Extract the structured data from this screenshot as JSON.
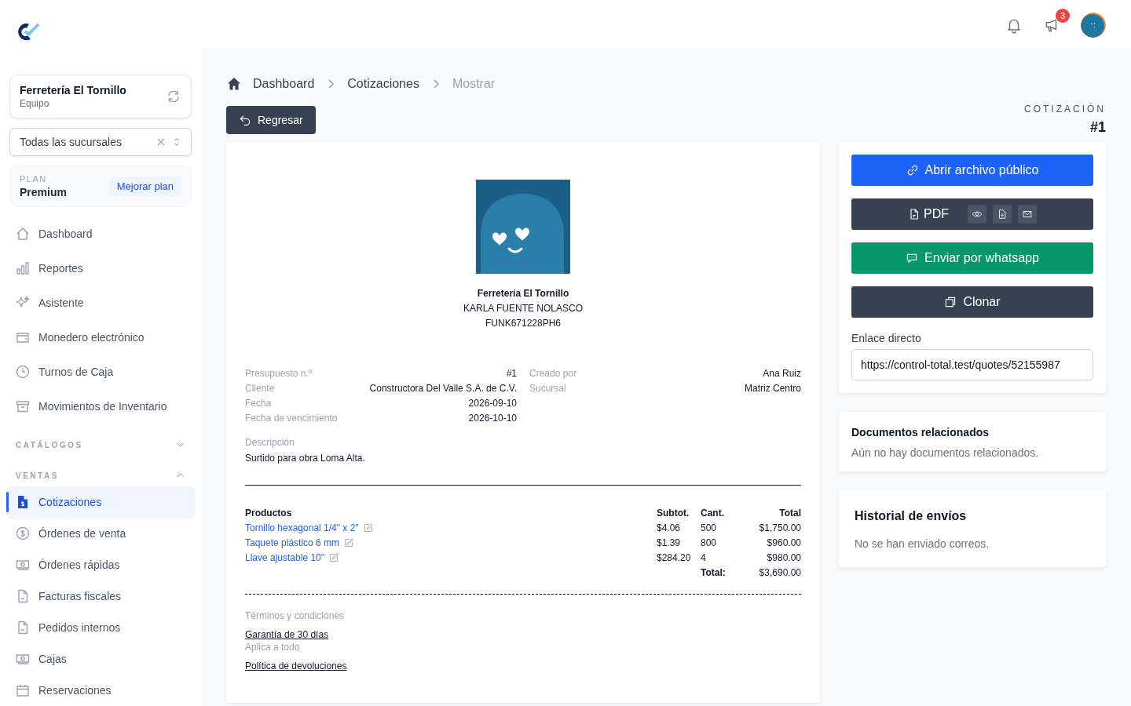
{
  "topbar": {
    "notification_count": "3"
  },
  "team": {
    "name": "Ferretería El Tornillo",
    "role": "Equipo"
  },
  "branch_select": {
    "value": "Todas las sucursales"
  },
  "plan": {
    "label": "PLAN",
    "name": "Premium",
    "upgrade": "Mejorar plan"
  },
  "sidebar": {
    "items": [
      {
        "label": "Dashboard",
        "selected": false
      },
      {
        "label": "Reportes",
        "selected": false
      },
      {
        "label": "Asistente",
        "selected": false
      },
      {
        "label": "Monedero electrónico",
        "selected": false
      },
      {
        "label": "Turnos de Caja",
        "selected": false
      },
      {
        "label": "Movimientos de Inventario",
        "selected": false
      }
    ],
    "sections": [
      {
        "title": "CATÁLOGOS",
        "expanded": false
      },
      {
        "title": "VENTAS",
        "expanded": true,
        "children": [
          {
            "label": "Cotizaciones",
            "selected": true
          },
          {
            "label": "Órdenes de venta",
            "selected": false
          },
          {
            "label": "Órdenes rápidas",
            "selected": false
          },
          {
            "label": "Facturas fiscales",
            "selected": false
          },
          {
            "label": "Pedidos internos",
            "selected": false
          },
          {
            "label": "Cajas",
            "selected": false
          },
          {
            "label": "Reservaciones",
            "selected": false
          }
        ]
      }
    ]
  },
  "breadcrumb": [
    {
      "label": "Dashboard",
      "current": false
    },
    {
      "label": "Cotizaciones",
      "current": false
    },
    {
      "label": "Mostrar",
      "current": true
    }
  ],
  "back_button": "Regresar",
  "doc_header": {
    "kind_label": "COTIZACIÓN",
    "number": "#1"
  },
  "quote": {
    "company": "Ferretería El Tornillo",
    "contact": "KARLA FUENTE NOLASCO",
    "tax_id": "FUNK671228PH6",
    "details_left": [
      {
        "label": "Presupuesto n.º",
        "value": "#1"
      },
      {
        "label": "Cliente",
        "value": "Constructora Del Valle S.A. de C.V."
      },
      {
        "label": "Fecha",
        "value": "2026-09-10"
      },
      {
        "label": "Fecha de vencimiento",
        "value": "2026-10-10"
      }
    ],
    "details_right": [
      {
        "label": "Creado por",
        "value": "Ana Ruiz"
      },
      {
        "label": "Sucursal",
        "value": "Matriz Centro"
      }
    ],
    "description_label": "Descripción",
    "description": "Surtido para obra Loma Alta.",
    "table": {
      "columns": [
        "Productos",
        "Subtot.",
        "Cant.",
        "Total"
      ],
      "rows": [
        {
          "product": "Tornillo hexagonal 1/4\" x 2\"",
          "subtotal": "$4.06",
          "qty": "500",
          "total": "$1,750.00"
        },
        {
          "product": "Taquete plástico 6 mm",
          "subtotal": "$1.39",
          "qty": "800",
          "total": "$960.00"
        },
        {
          "product": "Llave ajustable 10\"",
          "subtotal": "$284.20",
          "qty": "4",
          "total": "$980.00"
        }
      ],
      "total_label": "Total:",
      "total": "$3,690.00"
    },
    "terms_label": "Términos y condiciones",
    "terms": [
      {
        "title": "Garantía de 30 días",
        "scope": "Aplica a todo"
      },
      {
        "title": "Política de devoluciones"
      }
    ]
  },
  "actions": {
    "open_public": "Abrir archivo público",
    "pdf": "PDF",
    "whatsapp": "Enviar por whatsapp",
    "clone": "Clonar",
    "link_label": "Enlace directo",
    "link_value": "https://control-total.test/quotes/52155987"
  },
  "related": {
    "title": "Documentos relacionados",
    "empty": "Aún no hay documentos relacionados."
  },
  "history": {
    "title": "Historial de envíos",
    "empty": "No se han enviado correos."
  }
}
